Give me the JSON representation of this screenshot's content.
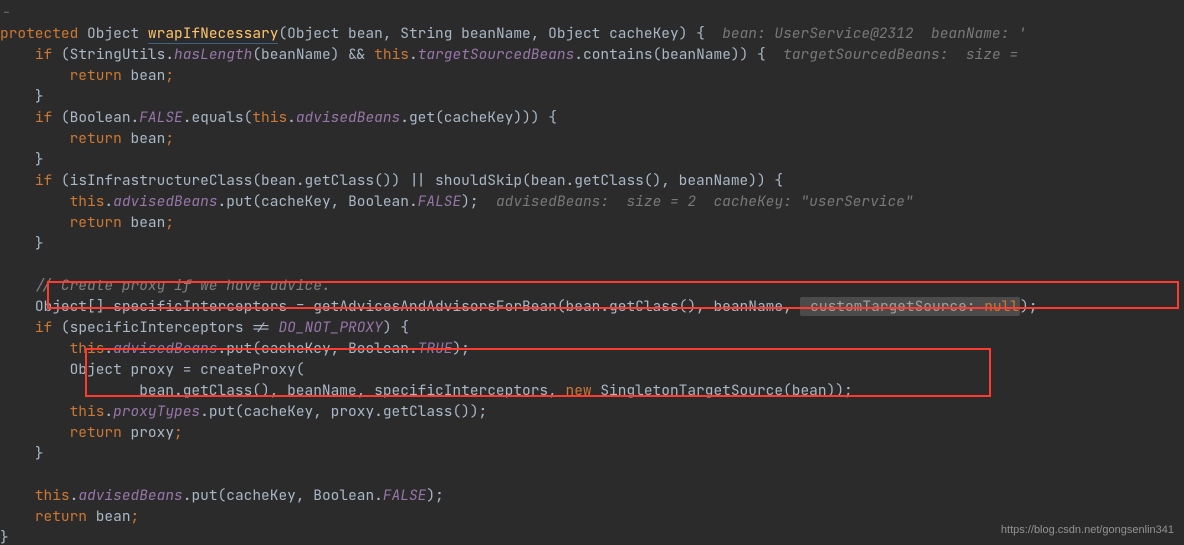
{
  "watermark": "https://blog.csdn.net/gongsenlin341",
  "gutter": "-",
  "code": {
    "l1_protected": "protected",
    "l1_Object": "Object",
    "l1_method": "wrapIfNecessary",
    "l1_p1t": "Object",
    "l1_p1n": "bean",
    "l1_p2t": "String",
    "l1_p2n": "beanName",
    "l1_p3t": "Object",
    "l1_p3n": "cacheKey",
    "l1_hint": "bean: UserService@2312  beanName: '",
    "l2_if": "if",
    "l2_cls": "StringUtils",
    "l2_hasLength": "hasLength",
    "l2_arg": "beanName",
    "l2_and": "&&",
    "l2_this": "this",
    "l2_field": "targetSourcedBeans",
    "l2_contains": "contains",
    "l2_arg2": "beanName",
    "l2_hint": "targetSourcedBeans:  size =",
    "l3_return": "return",
    "l3_val": "bean",
    "l5_if": "if",
    "l5_cls": "Boolean",
    "l5_false": "FALSE",
    "l5_equals": "equals",
    "l5_this": "this",
    "l5_field": "advisedBeans",
    "l5_get": "get",
    "l5_arg": "cacheKey",
    "l6_return": "return",
    "l6_val": "bean",
    "l8_if": "if",
    "l8_m1": "isInfrastructureClass",
    "l8_or": "||",
    "l8_m2": "shouldSkip",
    "l8_beangc": "bean.getClass()",
    "l8_bn": "beanName",
    "l9_this": "this",
    "l9_field": "advisedBeans",
    "l9_put": "put",
    "l9_ck": "cacheKey",
    "l9_cls": "Boolean",
    "l9_false": "FALSE",
    "l9_hint": "advisedBeans:  size = 2  cacheKey: \"userService\"",
    "l10_return": "return",
    "l10_val": "bean",
    "l13_comment": "// Create proxy if we have advice.",
    "l14_type": "Object[]",
    "l14_var": "specificInterceptors",
    "l14_m": "getAdvicesAndAdvisorsForBean",
    "l14_a1": "bean.getClass()",
    "l14_a2": "beanName",
    "l14_hint": "customTargetSource:",
    "l14_null": "null",
    "l15_if": "if",
    "l15_var": "specificInterceptors",
    "l15_ne": "!=",
    "l15_const": "DO_NOT_PROXY",
    "l16_this": "this",
    "l16_field": "advisedBeans",
    "l16_put": "put",
    "l16_ck": "cacheKey",
    "l16_cls": "Boolean",
    "l16_true": "TRUE",
    "l17_type": "Object",
    "l17_var": "proxy",
    "l17_m": "createProxy",
    "l18_a1": "bean.getClass()",
    "l18_a2": "beanName",
    "l18_a3": "specificInterceptors",
    "l18_new": "new",
    "l18_cls": "SingletonTargetSource",
    "l18_arg": "bean",
    "l19_this": "this",
    "l19_field": "proxyTypes",
    "l19_put": "put",
    "l19_ck": "cacheKey",
    "l19_pgc": "proxy.getClass()",
    "l20_return": "return",
    "l20_val": "proxy",
    "l23_this": "this",
    "l23_field": "advisedBeans",
    "l23_put": "put",
    "l23_ck": "cacheKey",
    "l23_cls": "Boolean",
    "l23_false": "FALSE",
    "l24_return": "return",
    "l24_val": "bean"
  }
}
